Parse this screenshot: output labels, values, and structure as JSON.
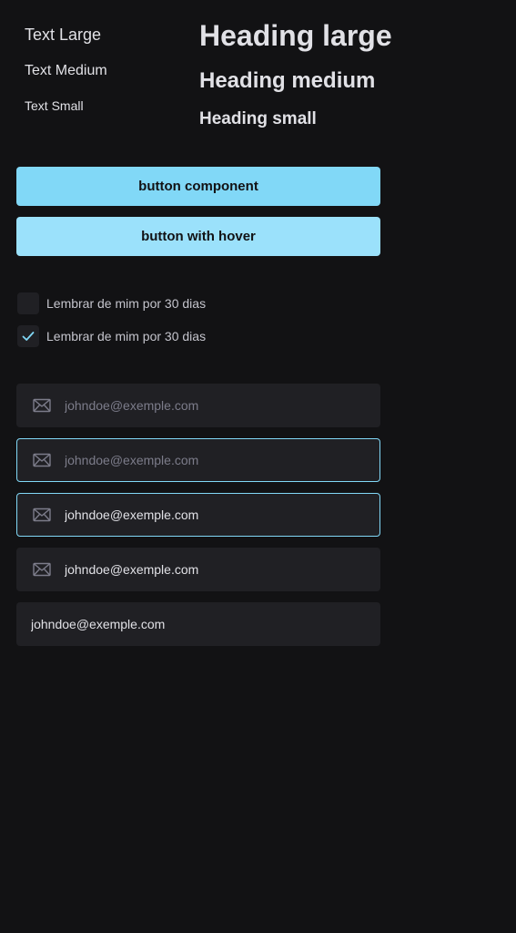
{
  "typography": {
    "text_large": "Text Large",
    "text_medium": "Text Medium",
    "text_small": "Text Small",
    "heading_large": "Heading large",
    "heading_medium": "Heading medium",
    "heading_small": "Heading small"
  },
  "buttons": {
    "primary_label": "button component",
    "hover_label": "button with hover"
  },
  "checkboxes": [
    {
      "label": "Lembrar de mim por 30 dias",
      "checked": false
    },
    {
      "label": "Lembrar de mim por 30 dias",
      "checked": true
    }
  ],
  "inputs": [
    {
      "placeholder": "johndoe@exemple.com",
      "value": "",
      "icon": "mail-icon",
      "state": "default"
    },
    {
      "placeholder": "johndoe@exemple.com",
      "value": "",
      "icon": "mail-icon",
      "state": "focused"
    },
    {
      "placeholder": "johndoe@exemple.com",
      "value": "johndoe@exemple.com",
      "icon": "mail-icon",
      "state": "focused"
    },
    {
      "placeholder": "johndoe@exemple.com",
      "value": "johndoe@exemple.com",
      "icon": "mail-icon",
      "state": "filled"
    },
    {
      "placeholder": "johndoe@exemple.com",
      "value": "johndoe@exemple.com",
      "icon": "none",
      "state": "filled"
    }
  ],
  "colors": {
    "background": "#121214",
    "surface": "#202024",
    "accent": "#81d8f7",
    "accent_hover": "#9be1fb",
    "text": "#e1e1e6",
    "placeholder": "#7c7c8a"
  }
}
